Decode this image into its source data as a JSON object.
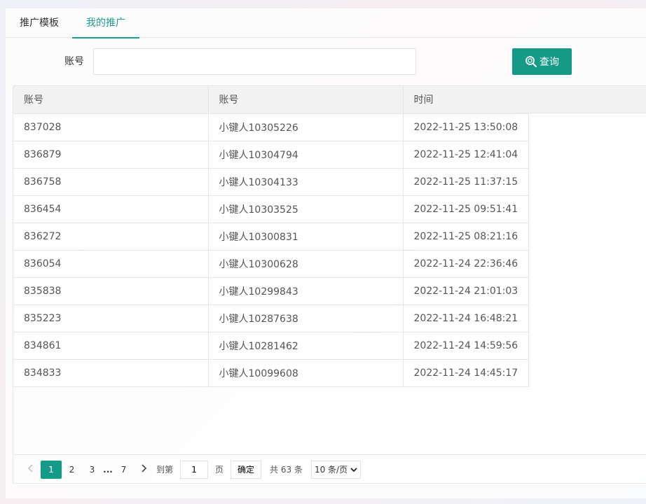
{
  "tabs": [
    {
      "label": "推广模板",
      "active": false
    },
    {
      "label": "我的推广",
      "active": true
    }
  ],
  "search": {
    "label": "账号",
    "value": "",
    "placeholder": "",
    "button_label": "查询",
    "button_icon": "search-icon"
  },
  "table": {
    "headers": [
      "账号",
      "账号",
      "时间"
    ],
    "rows": [
      [
        "837028",
        "小键人10305226",
        "2022-11-25 13:50:08"
      ],
      [
        "836879",
        "小键人10304794",
        "2022-11-25 12:41:04"
      ],
      [
        "836758",
        "小键人10304133",
        "2022-11-25 11:37:15"
      ],
      [
        "836454",
        "小键人10303525",
        "2022-11-25 09:51:41"
      ],
      [
        "836272",
        "小键人10300831",
        "2022-11-25 08:21:16"
      ],
      [
        "836054",
        "小键人10300628",
        "2022-11-24 22:36:46"
      ],
      [
        "835838",
        "小键人10299843",
        "2022-11-24 21:01:03"
      ],
      [
        "835223",
        "小键人10287638",
        "2022-11-24 16:48:21"
      ],
      [
        "834861",
        "小键人10281462",
        "2022-11-24 14:59:56"
      ],
      [
        "834833",
        "小键人10099608",
        "2022-11-24 14:45:17"
      ]
    ]
  },
  "pagination": {
    "prev_icon": "chevron-left-icon",
    "next_icon": "chevron-right-icon",
    "pages": [
      "1",
      "2",
      "3"
    ],
    "ellipsis": "...",
    "last_page": "7",
    "current_page": "1",
    "goto_prefix": "到第",
    "goto_value": "1",
    "goto_suffix": "页",
    "confirm_label": "确定",
    "total_text": "共 63 条",
    "page_size": "10 条/页"
  },
  "colors": {
    "accent": "#159a87",
    "tab_active": "#1e9e8a",
    "header_bg": "#f2f2f2"
  }
}
